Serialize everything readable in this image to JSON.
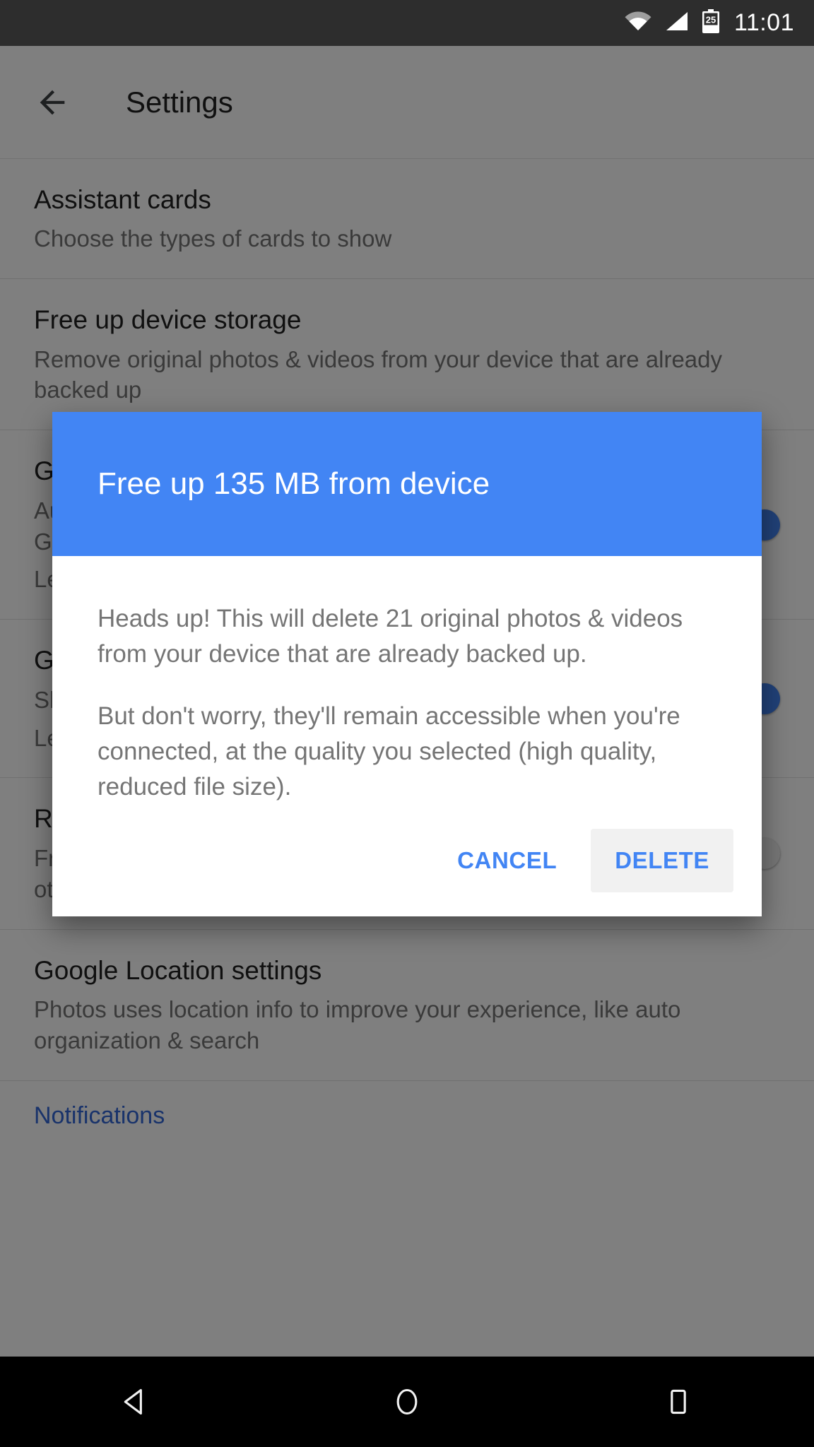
{
  "status_bar": {
    "time": "11:01",
    "battery_level": "25",
    "wifi_icon": "wifi-icon",
    "signal_icon": "cellular-signal-icon",
    "battery_icon": "battery-icon"
  },
  "toolbar": {
    "back_icon": "back-arrow-icon",
    "title": "Settings"
  },
  "settings_items": [
    {
      "name": "assistant-cards",
      "title": "Assistant cards",
      "subtitle": "Choose the types of cards to show",
      "toggle": null
    },
    {
      "name": "free-up-device-storage",
      "title": "Free up device storage",
      "subtitle": "Remove original photos & videos from your device that are already backed up",
      "toggle": null
    },
    {
      "name": "google-photos-backup",
      "title": "Google Photos backup",
      "subtitle": "Automatically back up your photos and videos to your Google account so you can see them on all of your devices",
      "link_label": "Learn more",
      "toggle": "on"
    },
    {
      "name": "google-drive",
      "title": "Google Drive",
      "subtitle": "Show Google Drive photos & videos in your Photos library",
      "link_label": "Learn more",
      "toggle": "on"
    },
    {
      "name": "remove-geo-location",
      "title": "Remove geo location",
      "subtitle": "From photos & videos that you share by link, but not by other means",
      "toggle": "off"
    },
    {
      "name": "google-location-settings",
      "title": "Google Location settings",
      "subtitle": "Photos uses location info to improve your experience, like auto organization & search",
      "toggle": null
    }
  ],
  "section_links": [
    {
      "name": "notifications",
      "label": "Notifications"
    }
  ],
  "dialog": {
    "title": "Free up 135 MB from device",
    "paragraph_1": "Heads up! This will delete 21 original photos & videos from your device that are already backed up.",
    "paragraph_2": "But don't worry, they'll remain accessible when you're connected, at the quality you selected (high quality, reduced file size).",
    "cancel_label": "CANCEL",
    "confirm_label": "DELETE",
    "header_color": "#4285f4",
    "action_color": "#4285f4",
    "focused_button_bg": "#f1f1f1",
    "storage_amount": "135 MB",
    "item_count": "21"
  },
  "nav_bar": {
    "back_icon": "nav-back-triangle-icon",
    "home_icon": "nav-home-circle-icon",
    "recents_icon": "nav-recents-square-icon"
  }
}
